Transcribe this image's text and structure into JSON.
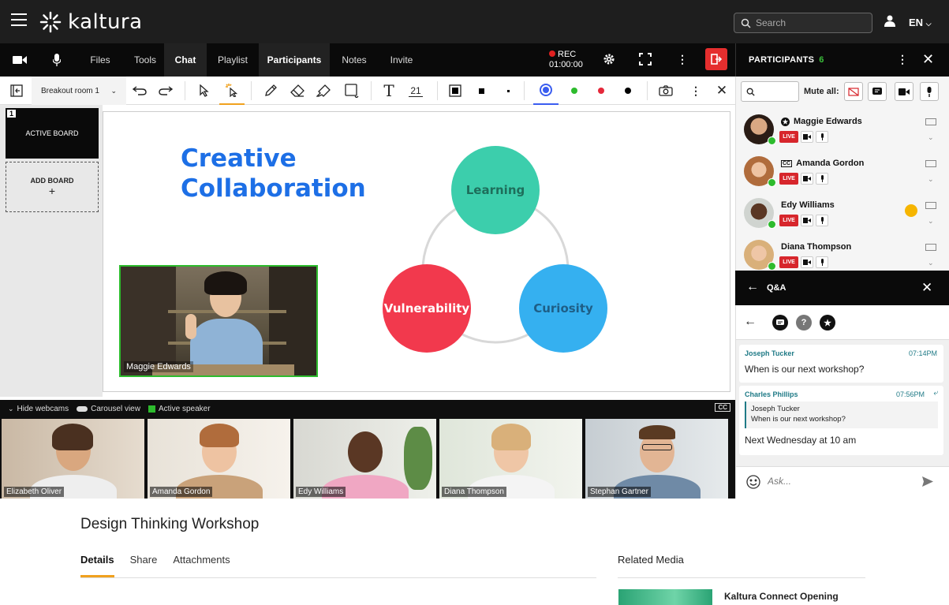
{
  "brand": {
    "name": "kaltura"
  },
  "header": {
    "search_placeholder": "Search",
    "lang": "EN"
  },
  "toolbar": {
    "tabs": [
      {
        "label": "Files"
      },
      {
        "label": "Tools"
      },
      {
        "label": "Chat"
      },
      {
        "label": "Playlist"
      },
      {
        "label": "Participants"
      },
      {
        "label": "Notes"
      },
      {
        "label": "Invite"
      }
    ],
    "rec_label": "REC",
    "rec_time": "01:00:00"
  },
  "whiteboard": {
    "room": "Breakout room 1",
    "font_size": "21",
    "board_number": "1",
    "active_board": "ACTIVE BOARD",
    "add_board": "ADD BOARD",
    "add_symbol": "+",
    "title_line1": "Creative",
    "title_line2": "Collaboration",
    "circles": [
      "Learning",
      "Vulnerability",
      "Curiosity"
    ],
    "presenter_name": "Maggie Edwards"
  },
  "webcams": {
    "hide_label": "Hide webcams",
    "carousel_label": "Carousel view",
    "active_speaker_label": "Active speaker",
    "cc": "CC",
    "people": [
      "Elizabeth Oliver",
      "Amanda Gordon",
      "Edy Williams",
      "Diana Thompson",
      "Stephan Gartner"
    ]
  },
  "participants": {
    "title": "PARTICIPANTS",
    "count": "6",
    "mute_all": "Mute all:",
    "live": "LIVE",
    "list": [
      {
        "name": "Maggie Edwards"
      },
      {
        "name": "Amanda Gordon"
      },
      {
        "name": "Edy Williams"
      },
      {
        "name": "Diana Thompson"
      }
    ]
  },
  "qa": {
    "title": "Q&A",
    "messages": [
      {
        "author": "Joseph Tucker",
        "time": "07:14PM",
        "text": "When is our next workshop?"
      },
      {
        "author": "Charles Phillips",
        "time": "07:56PM",
        "quote_author": "Joseph Tucker",
        "quote_text": "When is our next workshop?",
        "text": "Next Wednesday at 10 am"
      }
    ],
    "input_placeholder": "Ask..."
  },
  "entry": {
    "title": "Design Thinking Workshop",
    "tabs": [
      "Details",
      "Share",
      "Attachments"
    ],
    "related_title": "Related Media",
    "related_item": "Kaltura Connect Opening"
  },
  "colors": {
    "accent_orange": "#f0a11e",
    "live_red": "#d7262c",
    "online_green": "#2dbb2d",
    "title_blue": "#1d6fe6",
    "learning": "#3cceac",
    "vulnerability": "#f2394d",
    "curiosity": "#35b0f0"
  }
}
